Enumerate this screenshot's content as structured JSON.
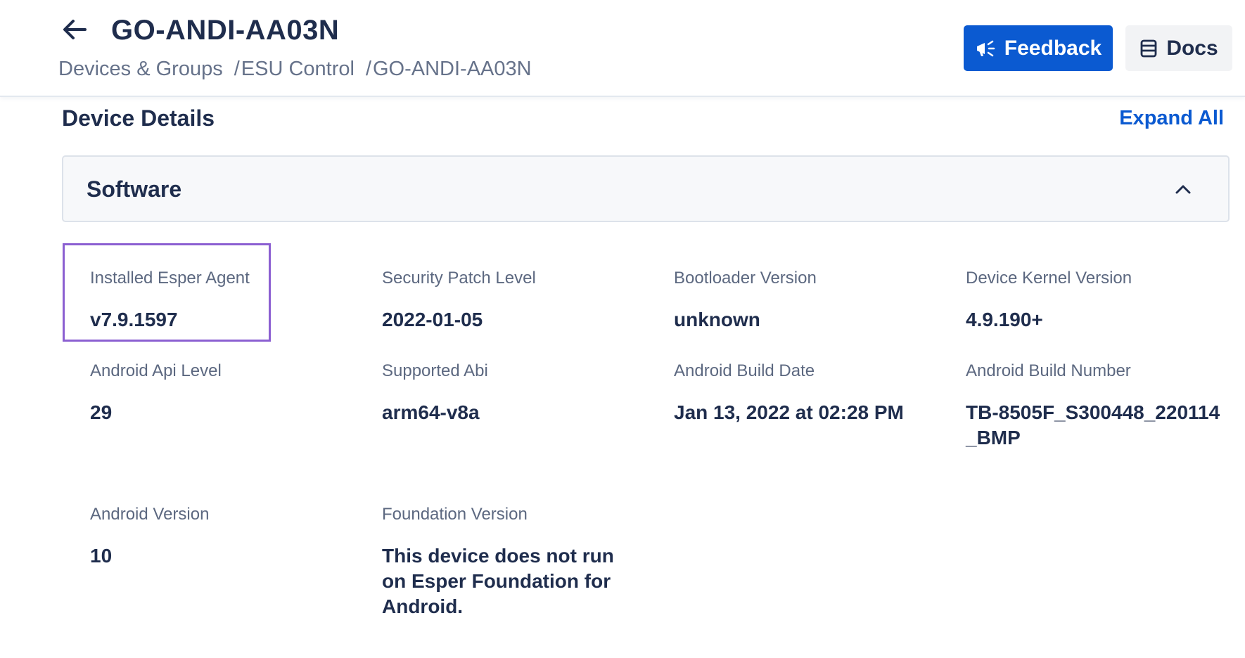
{
  "header": {
    "title": "GO-ANDI-AA03N",
    "breadcrumb": [
      {
        "label": "Devices & Groups"
      },
      {
        "label": "ESU Control"
      },
      {
        "label": "GO-ANDI-AA03N"
      }
    ],
    "breadcrumb_separator": "/",
    "feedback_label": "Feedback",
    "docs_label": "Docs",
    "feedback_icon": "megaphone-icon",
    "docs_icon": "book-icon",
    "back_icon": "arrow-left-icon"
  },
  "details": {
    "title": "Device Details",
    "expand_all_label": "Expand All",
    "section": {
      "title": "Software",
      "state": "expanded",
      "chevron_icon": "chevron-up-icon"
    },
    "fields": [
      {
        "label": "Installed Esper Agent",
        "value": "v7.9.1597"
      },
      {
        "label": "Security Patch Level",
        "value": "2022-01-05"
      },
      {
        "label": "Bootloader Version",
        "value": "unknown"
      },
      {
        "label": "Device Kernel Version",
        "value": "4.9.190+"
      },
      {
        "label": "Android Api Level",
        "value": "29"
      },
      {
        "label": "Supported Abi",
        "value": "arm64-v8a"
      },
      {
        "label": "Android Build Date",
        "value": "Jan 13, 2022 at 02:28 PM"
      },
      {
        "label": "Android Build Number",
        "value": "TB-8505F_S300448_220114_BMP"
      },
      {
        "label": "Android Version",
        "value": "10"
      },
      {
        "label": "Foundation Version",
        "value": "This device does not run on Esper Foundation for Android."
      }
    ]
  },
  "colors": {
    "primary": "#0b5ad1",
    "text": "#1f2d4d",
    "muted": "#66728a",
    "highlight": "#8b5fd1"
  }
}
